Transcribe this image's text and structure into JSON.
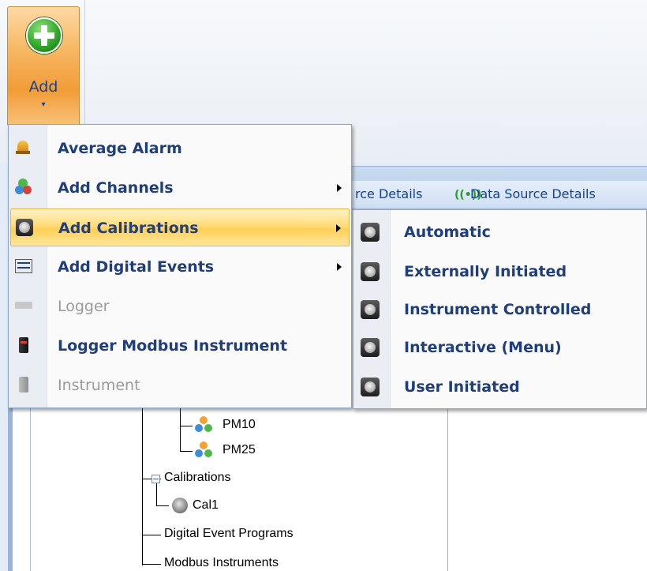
{
  "ribbon": {
    "add_label": "Add",
    "add_caret": "▾"
  },
  "tabs": [
    {
      "label": "rce Details"
    },
    {
      "label": "Data Source Details"
    }
  ],
  "add_menu": {
    "items": [
      {
        "label": "Average Alarm",
        "icon": "bell-icon",
        "submenu": false,
        "enabled": true
      },
      {
        "label": "Add Channels",
        "icon": "channels-icon",
        "submenu": true,
        "enabled": true
      },
      {
        "label": "Add Calibrations",
        "icon": "gauge-icon",
        "submenu": true,
        "enabled": true,
        "highlighted": true
      },
      {
        "label": "Add Digital Events",
        "icon": "digital-events-icon",
        "submenu": true,
        "enabled": true
      },
      {
        "label": "Logger",
        "icon": "logger-icon",
        "submenu": false,
        "enabled": false
      },
      {
        "label": "Logger Modbus Instrument",
        "icon": "modbus-instrument-icon",
        "submenu": false,
        "enabled": true
      },
      {
        "label": "Instrument",
        "icon": "instrument-icon",
        "submenu": false,
        "enabled": false
      }
    ]
  },
  "calibrations_submenu": {
    "items": [
      {
        "label": "Automatic",
        "icon": "gauge-icon"
      },
      {
        "label": "Externally Initiated",
        "icon": "gauge-icon"
      },
      {
        "label": "Instrument Controlled",
        "icon": "gauge-icon"
      },
      {
        "label": "Interactive (Menu)",
        "icon": "gauge-icon"
      },
      {
        "label": "User Initiated",
        "icon": "gauge-icon"
      }
    ]
  },
  "tree": {
    "channels": [
      "PM10",
      "PM25"
    ],
    "calibrations_label": "Calibrations",
    "calibrations": [
      "Cal1"
    ],
    "digital_event_programs": "Digital Event Programs",
    "modbus_instruments": "Modbus Instruments"
  },
  "colors": {
    "menu_text": "#1f3e7c",
    "highlight": "#ffd466",
    "ribbon_button": "#f4a84a",
    "add_icon_green": "#33a82a"
  }
}
